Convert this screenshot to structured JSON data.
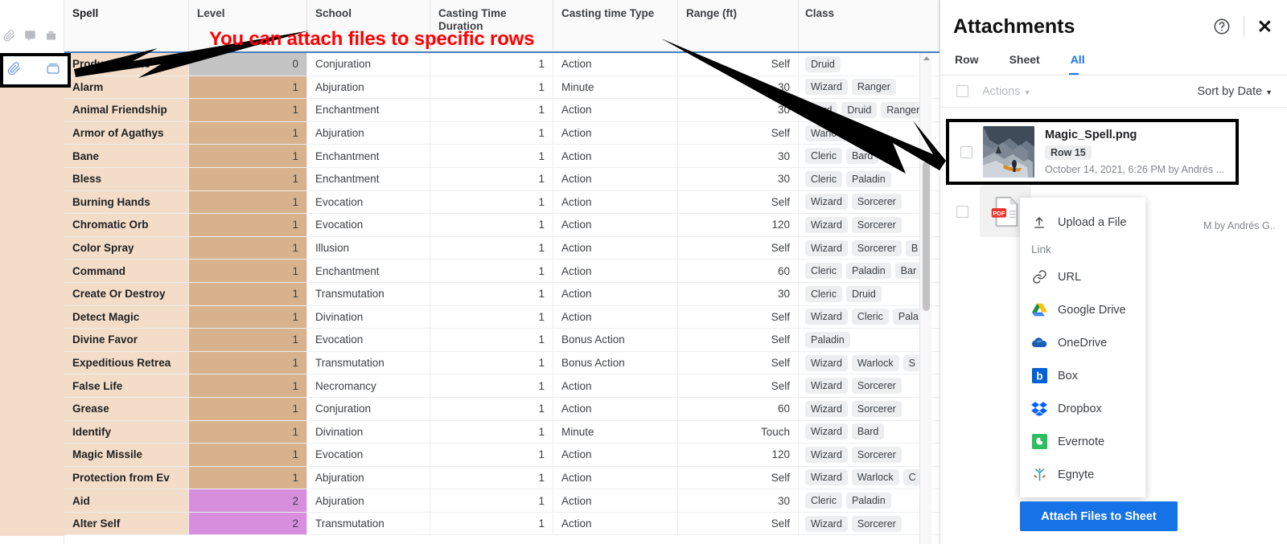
{
  "annotation": {
    "text": "You can attach files to specific rows",
    "color": "#ff0000"
  },
  "gutter": {
    "icons": [
      "paperclip-icon",
      "comment-icon",
      "proof-icon",
      "info-icon"
    ],
    "callout_icons": [
      "paperclip-icon",
      "attachment-box-icon"
    ]
  },
  "grid": {
    "columns": [
      {
        "label": "Spell"
      },
      {
        "label": "Level"
      },
      {
        "label": "School"
      },
      {
        "label": "Casting Time Duration"
      },
      {
        "label": "Casting time Type"
      },
      {
        "label": "Range (ft)"
      },
      {
        "label": "Class"
      }
    ],
    "rows": [
      {
        "spell": "Produce Flame",
        "level": "0",
        "level_color": "#c4c4c4",
        "school": "Conjuration",
        "casting_time_duration": "1",
        "casting_time_type": "Action",
        "range": "Self",
        "classes": [
          "Druid"
        ]
      },
      {
        "spell": "Alarm",
        "level": "1",
        "level_color": "#d7b28c",
        "school": "Abjuration",
        "casting_time_duration": "1",
        "casting_time_type": "Minute",
        "range": "30",
        "classes": [
          "Wizard",
          "Ranger"
        ]
      },
      {
        "spell": "Animal Friendship",
        "level": "1",
        "level_color": "#d7b28c",
        "school": "Enchantment",
        "casting_time_duration": "1",
        "casting_time_type": "Action",
        "range": "30",
        "classes": [
          "Bard",
          "Druid",
          "Ranger"
        ]
      },
      {
        "spell": "Armor of Agathys",
        "level": "1",
        "level_color": "#d7b28c",
        "school": "Abjuration",
        "casting_time_duration": "1",
        "casting_time_type": "Action",
        "range": "Self",
        "classes": [
          "Warlock"
        ]
      },
      {
        "spell": "Bane",
        "level": "1",
        "level_color": "#d7b28c",
        "school": "Enchantment",
        "casting_time_duration": "1",
        "casting_time_type": "Action",
        "range": "30",
        "classes": [
          "Cleric",
          "Bard"
        ]
      },
      {
        "spell": "Bless",
        "level": "1",
        "level_color": "#d7b28c",
        "school": "Enchantment",
        "casting_time_duration": "1",
        "casting_time_type": "Action",
        "range": "30",
        "classes": [
          "Cleric",
          "Paladin"
        ]
      },
      {
        "spell": "Burning Hands",
        "level": "1",
        "level_color": "#d7b28c",
        "school": "Evocation",
        "casting_time_duration": "1",
        "casting_time_type": "Action",
        "range": "Self",
        "classes": [
          "Wizard",
          "Sorcerer"
        ]
      },
      {
        "spell": "Chromatic Orb",
        "level": "1",
        "level_color": "#d7b28c",
        "school": "Evocation",
        "casting_time_duration": "1",
        "casting_time_type": "Action",
        "range": "120",
        "classes": [
          "Wizard",
          "Sorcerer"
        ]
      },
      {
        "spell": "Color Spray",
        "level": "1",
        "level_color": "#d7b28c",
        "school": "Illusion",
        "casting_time_duration": "1",
        "casting_time_type": "Action",
        "range": "Self",
        "classes": [
          "Wizard",
          "Sorcerer",
          "B"
        ]
      },
      {
        "spell": "Command",
        "level": "1",
        "level_color": "#d7b28c",
        "school": "Enchantment",
        "casting_time_duration": "1",
        "casting_time_type": "Action",
        "range": "60",
        "classes": [
          "Cleric",
          "Paladin",
          "Bar"
        ]
      },
      {
        "spell": "Create Or Destroy",
        "level": "1",
        "level_color": "#d7b28c",
        "school": "Transmutation",
        "casting_time_duration": "1",
        "casting_time_type": "Action",
        "range": "30",
        "classes": [
          "Cleric",
          "Druid"
        ]
      },
      {
        "spell": "Detect Magic",
        "level": "1",
        "level_color": "#d7b28c",
        "school": "Divination",
        "casting_time_duration": "1",
        "casting_time_type": "Action",
        "range": "Self",
        "classes": [
          "Wizard",
          "Cleric",
          "Pala"
        ]
      },
      {
        "spell": "Divine Favor",
        "level": "1",
        "level_color": "#d7b28c",
        "school": "Evocation",
        "casting_time_duration": "1",
        "casting_time_type": "Bonus Action",
        "range": "Self",
        "classes": [
          "Paladin"
        ]
      },
      {
        "spell": "Expeditious Retrea",
        "level": "1",
        "level_color": "#d7b28c",
        "school": "Transmutation",
        "casting_time_duration": "1",
        "casting_time_type": "Bonus Action",
        "range": "Self",
        "classes": [
          "Wizard",
          "Warlock",
          "S"
        ]
      },
      {
        "spell": "False Life",
        "level": "1",
        "level_color": "#d7b28c",
        "school": "Necromancy",
        "casting_time_duration": "1",
        "casting_time_type": "Action",
        "range": "Self",
        "classes": [
          "Wizard",
          "Sorcerer"
        ]
      },
      {
        "spell": "Grease",
        "level": "1",
        "level_color": "#d7b28c",
        "school": "Conjuration",
        "casting_time_duration": "1",
        "casting_time_type": "Action",
        "range": "60",
        "classes": [
          "Wizard",
          "Sorcerer"
        ]
      },
      {
        "spell": "Identify",
        "level": "1",
        "level_color": "#d7b28c",
        "school": "Divination",
        "casting_time_duration": "1",
        "casting_time_type": "Minute",
        "range": "Touch",
        "classes": [
          "Wizard",
          "Bard"
        ]
      },
      {
        "spell": "Magic Missile",
        "level": "1",
        "level_color": "#d7b28c",
        "school": "Evocation",
        "casting_time_duration": "1",
        "casting_time_type": "Action",
        "range": "120",
        "classes": [
          "Wizard",
          "Sorcerer"
        ]
      },
      {
        "spell": "Protection from Ev",
        "level": "1",
        "level_color": "#d7b28c",
        "school": "Abjuration",
        "casting_time_duration": "1",
        "casting_time_type": "Action",
        "range": "Self",
        "classes": [
          "Wizard",
          "Warlock",
          "C"
        ]
      },
      {
        "spell": "Aid",
        "level": "2",
        "level_color": "#d78fdd",
        "school": "Abjuration",
        "casting_time_duration": "1",
        "casting_time_type": "Action",
        "range": "30",
        "classes": [
          "Cleric",
          "Paladin"
        ]
      },
      {
        "spell": "Alter Self",
        "level": "2",
        "level_color": "#d78fdd",
        "school": "Transmutation",
        "casting_time_duration": "1",
        "casting_time_type": "Action",
        "range": "Self",
        "classes": [
          "Wizard",
          "Sorcerer"
        ]
      }
    ]
  },
  "panel": {
    "title": "Attachments",
    "help_icon": "question-circle-icon",
    "close_icon": "close-icon",
    "tabs": [
      {
        "label": "Row",
        "active": false
      },
      {
        "label": "Sheet",
        "active": false
      },
      {
        "label": "All",
        "active": true
      }
    ],
    "toolbar": {
      "actions_label": "Actions",
      "sort_label": "Sort by Date"
    },
    "attachments": [
      {
        "name": "Magic_Spell.png",
        "row_badge": "Row 15",
        "meta": "October 14, 2021, 6:26 PM by Andrés ...",
        "thumb": "image-thumbnail",
        "highlighted": true
      },
      {
        "name": "",
        "row_badge": "",
        "meta": "M by Andrés G...",
        "thumb": "pdf-icon",
        "highlighted": false
      }
    ],
    "dropdown": {
      "upload_label": "Upload a File",
      "upload_icon": "upload-icon",
      "link_section_label": "Link",
      "items": [
        {
          "label": "URL",
          "icon": "link-icon"
        },
        {
          "label": "Google Drive",
          "icon": "google-drive-icon"
        },
        {
          "label": "OneDrive",
          "icon": "onedrive-icon"
        },
        {
          "label": "Box",
          "icon": "box-icon"
        },
        {
          "label": "Dropbox",
          "icon": "dropbox-icon"
        },
        {
          "label": "Evernote",
          "icon": "evernote-icon"
        },
        {
          "label": "Egnyte",
          "icon": "egnyte-icon"
        }
      ]
    },
    "attach_button": {
      "label": "Attach Files to Sheet",
      "color": "#1673e6"
    }
  }
}
